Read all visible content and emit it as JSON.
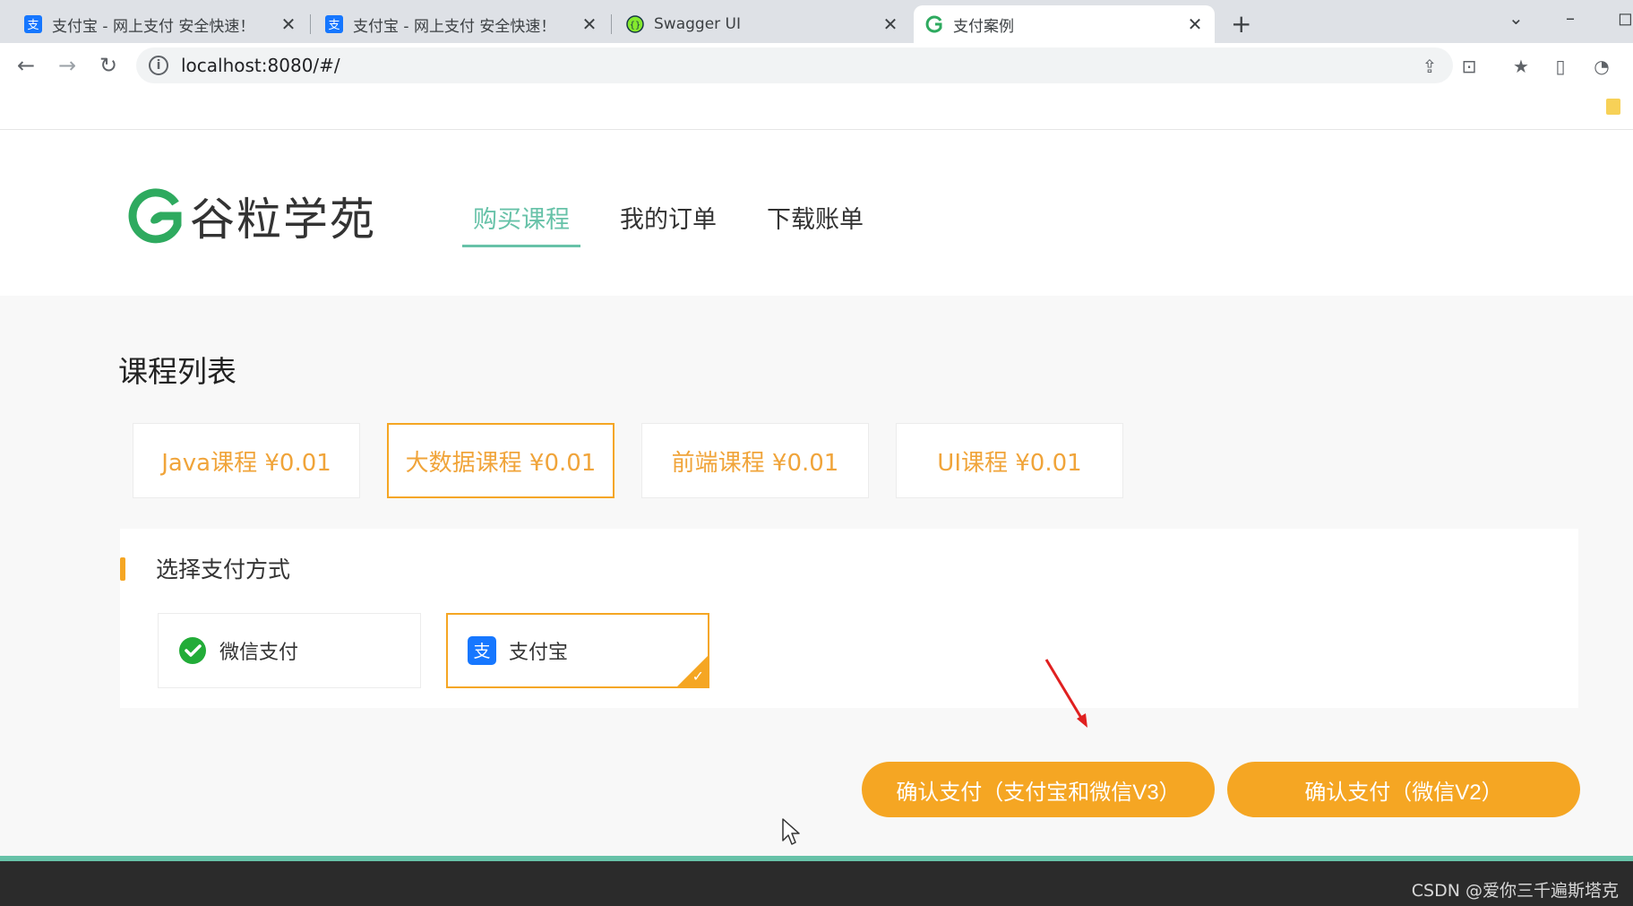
{
  "browser": {
    "tabs": [
      {
        "title": "支付宝 - 网上支付 安全快速！",
        "icon": "alipay-icon",
        "active": false
      },
      {
        "title": "支付宝 - 网上支付 安全快速！",
        "icon": "alipay-icon",
        "active": false
      },
      {
        "title": "Swagger UI",
        "icon": "swagger-icon",
        "active": false
      },
      {
        "title": "支付案例",
        "icon": "guli-logo-icon",
        "active": true
      }
    ],
    "new_tab": "+",
    "url": "localhost:8080/#/"
  },
  "header": {
    "logo_text": "谷粒学苑",
    "nav": [
      {
        "label": "购买课程",
        "active": true
      },
      {
        "label": "我的订单",
        "active": false
      },
      {
        "label": "下载账单",
        "active": false
      }
    ]
  },
  "courses": {
    "title": "课程列表",
    "items": [
      {
        "label": "Java课程 ¥0.01",
        "selected": false
      },
      {
        "label": "大数据课程 ¥0.01",
        "selected": true
      },
      {
        "label": "前端课程 ¥0.01",
        "selected": false
      },
      {
        "label": "UI课程 ¥0.01",
        "selected": false
      }
    ]
  },
  "payment": {
    "title": "选择支付方式",
    "methods": [
      {
        "label": "微信支付",
        "icon": "wechat-pay-icon",
        "selected": false
      },
      {
        "label": "支付宝",
        "icon": "alipay-icon",
        "selected": true
      }
    ]
  },
  "actions": {
    "confirm_v3": "确认支付（支付宝和微信V3）",
    "confirm_v2": "确认支付（微信V2）"
  },
  "footer": {
    "watermark": "CSDN @爱你三千遍斯塔克"
  },
  "colors": {
    "accent_green": "#67c2a8",
    "accent_orange": "#f5a623",
    "price_orange": "#f0a43a"
  }
}
